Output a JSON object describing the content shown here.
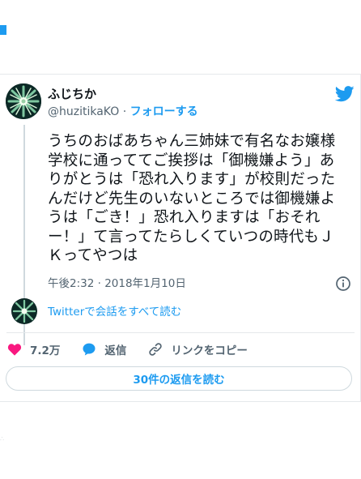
{
  "user": {
    "display_name": "ふじちか",
    "handle": "@huzitikaKO",
    "separator": " · ",
    "follow_label": "フォローする"
  },
  "tweet": {
    "text": "うちのおばあちゃん三姉妹で有名なお嬢様学校に通っててご挨拶は「御機嫌よう」ありがとうは「恐れ入ります」が校則だったんだけど先生のいないところでは御機嫌ようは「ごき！」恐れ入りますは「おそれー！」て言ってたらしくていつの時代もＪＫってやつは",
    "timestamp": "午後2:32 · 2018年1月10日"
  },
  "conversation": {
    "read_all_label": "Twitterで会話をすべて読む"
  },
  "actions": {
    "likes": "7.2万",
    "reply_label": "返信",
    "copy_link_label": "リンクをコピー"
  },
  "replies_button": "30件の返信を読む",
  "icons": [
    "twitter-bird-icon",
    "info-icon",
    "heart-icon",
    "reply-bubble-icon",
    "link-icon"
  ],
  "colors": {
    "accent": "#1d9bf0",
    "heart": "#f91880",
    "text": "#0f1419",
    "muted": "#536471",
    "border": "#e5e8eb"
  }
}
